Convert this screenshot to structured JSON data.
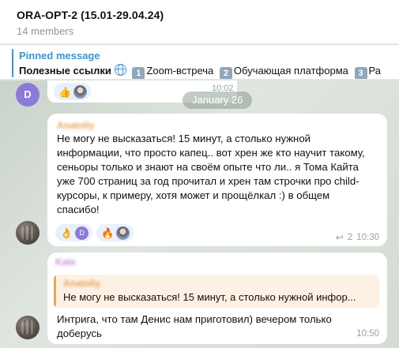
{
  "header": {
    "title": "ORA-OPT-2 (15.01-29.04.24)",
    "members": "14 members"
  },
  "pinned": {
    "label": "Pinned message",
    "prefix": "Полезные ссылки",
    "items": [
      {
        "num": "1",
        "text": "Zoom-встреча"
      },
      {
        "num": "2",
        "text": "Обучающая платформа"
      },
      {
        "num": "3",
        "text": "Ра"
      }
    ]
  },
  "chat": {
    "top_avatar_letter": "D",
    "top_time": "10:02",
    "top_reactions": [
      {
        "emoji": "👍",
        "avatar": "photo"
      }
    ],
    "date": "January 26",
    "messages": [
      {
        "sender": "Anatoliy",
        "text_lines": [
          "Не могу не высказаться! 15 минут, а столько нужной",
          "информации, что просто капец.. вот хрен же кто научит такому,",
          "сеньоры только и знают на своём опыте что ли.. я Тома Кайта",
          "уже 700 страниц за год прочитал и хрен там строчки про child-",
          "курсоры, к примеру, хотя может и прощёлкал :) в общем",
          "спасибо!"
        ],
        "reactions": [
          {
            "emoji": "👌",
            "avatar_letter": "D"
          },
          {
            "emoji": "🔥",
            "avatar": "photo"
          }
        ],
        "replies": "2",
        "time": "10:30"
      },
      {
        "sender": "Kate",
        "quote_name": "Anatoliy",
        "quote_text": "Не могу не высказаться! 15 минут, а столько нужной инфор...",
        "text_lines": [
          "Интрига, что там Денис нам приготовил) вечером только",
          "доберусь"
        ],
        "time": "10:50"
      }
    ]
  },
  "colors": {
    "accent": "#3a95d5",
    "sender_orange": "#e6a55e",
    "reaction_bg": "#e8f1fb",
    "chat_bg": "#dde3dc"
  }
}
